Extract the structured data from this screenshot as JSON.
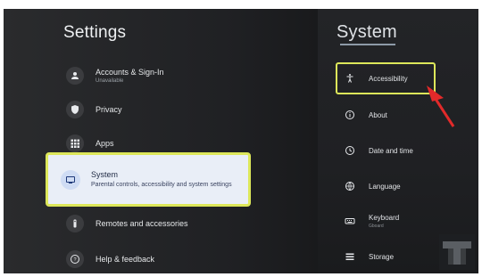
{
  "left_panel": {
    "title": "Settings",
    "items": [
      {
        "label": "Accounts & Sign-In",
        "sublabel": "Unavailable",
        "icon": "account-icon"
      },
      {
        "label": "Privacy",
        "icon": "shield-icon"
      },
      {
        "label": "Apps",
        "icon": "apps-grid-icon"
      },
      {
        "label": "System",
        "description": "Parental controls, accessibility and system settings",
        "icon": "tv-icon",
        "selected": true
      },
      {
        "label": "Remotes and accessories",
        "icon": "remote-icon"
      },
      {
        "label": "Help & feedback",
        "icon": "help-icon"
      }
    ]
  },
  "right_panel": {
    "title": "System",
    "items": [
      {
        "label": "Accessibility",
        "icon": "accessibility-icon",
        "highlighted": true
      },
      {
        "label": "About",
        "icon": "info-icon"
      },
      {
        "label": "Date and time",
        "icon": "clock-icon"
      },
      {
        "label": "Language",
        "icon": "globe-icon"
      },
      {
        "label": "Keyboard",
        "sublabel": "Gboard",
        "icon": "keyboard-icon"
      },
      {
        "label": "Storage",
        "icon": "storage-icon"
      }
    ]
  },
  "colors": {
    "highlight": "#dde75a",
    "arrow": "#e22a2a",
    "selected_bg": "#e9eef7"
  }
}
